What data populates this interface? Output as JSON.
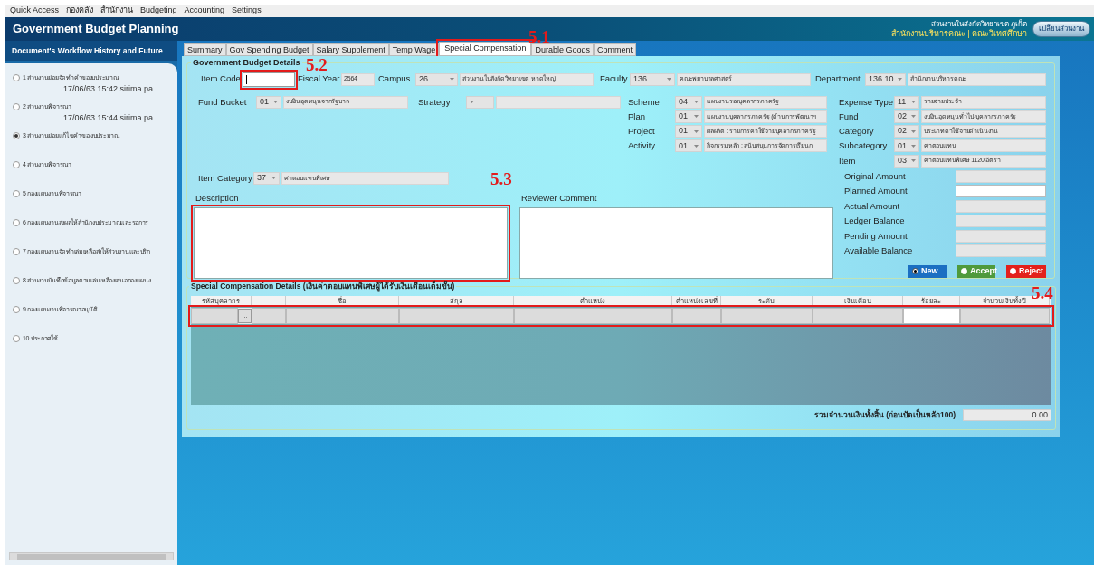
{
  "menu": [
    "Quick Access",
    "กองคลัง",
    "สำนักงาน",
    "Budgeting",
    "Accounting",
    "Settings"
  ],
  "header": {
    "title": "Government Budget Planning",
    "org_line": "ส่วนงานในสังกัดวิทยาเขต ภูเก็ต",
    "unit_line": "สำนักงานบริหารคณะ | คณะวิเทศศึกษา",
    "switch_button": "เปลี่ยนส่วนงาน"
  },
  "sidebar": {
    "title": "Document's Workflow History and Future",
    "steps": [
      {
        "label": "1 ส่วนงานย่อยจัดทำคำของบประมาณ",
        "note": "17/06/63 15:42 sirima.pa",
        "selected": false
      },
      {
        "label": "2 ส่วนงานพิจารณา",
        "note": "17/06/63 15:44 sirima.pa",
        "selected": false
      },
      {
        "label": "3 ส่วนงานย่อยแก้ไขคำขอ งบประมาณ",
        "selected": true
      },
      {
        "label": "4 ส่วนงานพิจารณา",
        "selected": false
      },
      {
        "label": "5 กองแผนงานพิจารณา",
        "selected": false
      },
      {
        "label": "6 กองแผนงานส่งผลให้สำนักงบประมาณและรอการ",
        "selected": false
      },
      {
        "label": "7 กองแผนงานจัดทำเล่มเหลือส่งให้ส่วนงานและบริก",
        "selected": false
      },
      {
        "label": "8 ส่วนงานบันทึกข้อมูลตามเล่มเหลืองเสนอกองแผนง",
        "selected": false
      },
      {
        "label": "9 กองแผนงานพิจารณาอนุมัติ",
        "selected": false
      },
      {
        "label": "10 ประกาศใช้",
        "selected": false
      }
    ]
  },
  "tabs": [
    {
      "label": "Summary",
      "selected": false
    },
    {
      "label": "Gov Spending Budget",
      "selected": false
    },
    {
      "label": "Salary Supplement",
      "selected": false
    },
    {
      "label": "Temp Wage",
      "selected": false
    },
    {
      "label": "Special Compensation",
      "selected": true,
      "callout": "5.1"
    },
    {
      "label": "Durable Goods",
      "selected": false
    },
    {
      "label": "Comment",
      "selected": false
    }
  ],
  "budget_details": {
    "title": "Government Budget Details",
    "top_fields": [
      {
        "kind": "input",
        "label": "Item Code",
        "focused": true,
        "callout": "5.2"
      },
      {
        "kind": "text",
        "label": "Fiscal Year",
        "value": "2564"
      },
      {
        "kind": "select",
        "label": "Campus",
        "code": "26",
        "text": "ส่วนงานในสังกัดวิทยาเขต หาดใหญ่"
      },
      {
        "kind": "select",
        "label": "Faculty",
        "code": "136",
        "text": "คณะพยาบาลศาสตร์"
      },
      {
        "kind": "select",
        "label": "Department",
        "code": "136.10",
        "text": "สำนักงานบริหารคณะ"
      }
    ],
    "fund_bucket": {
      "label": "Fund Bucket",
      "code": "01",
      "text": "งบเงินอุดหนุนจากรัฐบาล"
    },
    "strategy": {
      "label": "Strategy"
    },
    "program_fields": [
      {
        "label": "Scheme",
        "code": "04",
        "text": "แผนงานรองบุคลากรภาครัฐ"
      },
      {
        "label": "Plan",
        "code": "01",
        "text": "แผนงานบุคลากรภาครัฐ (ด้านการพัฒนาฯ"
      },
      {
        "label": "Project",
        "code": "01",
        "text": "ผลผลิต : รายการค่าใช้จ่ายบุคลากรภาครัฐ"
      },
      {
        "label": "Activity",
        "code": "01",
        "text": "กิจกรรมหลัก : สนับสนุนการจัดการเรียนก"
      }
    ],
    "classification_fields": [
      {
        "label": "Expense Type",
        "code": "11",
        "text": "รายจ่ายประจำ"
      },
      {
        "label": "Fund",
        "code": "02",
        "text": "งบเงินอุดหนุนทั่วไป-บุคลากรภาครัฐ"
      },
      {
        "label": "Category",
        "code": "02",
        "text": "ประเภทค่าใช้จ่ายดำเนินงาน"
      },
      {
        "label": "Subcategory",
        "code": "01",
        "text": "ค่าตอบแทน"
      },
      {
        "label": "Item",
        "code": "03",
        "text": "ค่าตอบแทนพิเศษ 1120 อัตรา"
      }
    ],
    "item_category": {
      "label": "Item Category",
      "code": "37",
      "text": "ค่าตอบแทนพิเศษ"
    },
    "description": {
      "label": "Description",
      "callout": "5.3"
    },
    "reviewer_comment": {
      "label": "Reviewer Comment"
    },
    "amounts": [
      {
        "label": "Original Amount",
        "editable": false
      },
      {
        "label": "Planned Amount",
        "editable": true
      },
      {
        "label": "Actual Amount",
        "editable": false
      },
      {
        "label": "Ledger Balance",
        "editable": false
      },
      {
        "label": "Pending Amount",
        "editable": false
      },
      {
        "label": "Available Balance",
        "editable": false
      }
    ],
    "status_buttons": [
      {
        "label": "New",
        "kind": "new",
        "selected": true
      },
      {
        "label": "Accept",
        "kind": "accept",
        "selected": false
      },
      {
        "label": "Reject",
        "kind": "reject",
        "selected": false
      }
    ]
  },
  "details_table": {
    "title": "Special Compensation Details (เงินค่าตอบแทนพิเศษผู้ได้รับเงินเดือนเต็มขั้น)",
    "callout": "5.4",
    "columns": [
      {
        "label": "รหัสบุคลากร",
        "editable": false
      },
      {
        "editable": false
      },
      {
        "label": "ชื่อ",
        "editable": false
      },
      {
        "label": "สกุล",
        "editable": false
      },
      {
        "label": "ตำแหน่ง",
        "editable": false
      },
      {
        "label": "ตำแหน่งเลขที่",
        "editable": false
      },
      {
        "label": "ระดับ",
        "editable": false
      },
      {
        "label": "เงินเดือน",
        "editable": false
      },
      {
        "label": "ร้อยละ",
        "editable": true
      },
      {
        "label": "จำนวนเงินทั้งปี",
        "editable": false
      }
    ],
    "lookup_button": "...",
    "total": {
      "label": "รวมจำนวนเงินทั้งสิ้น (ก่อนปัดเป็นหลัก100)",
      "value": "0.00"
    }
  }
}
